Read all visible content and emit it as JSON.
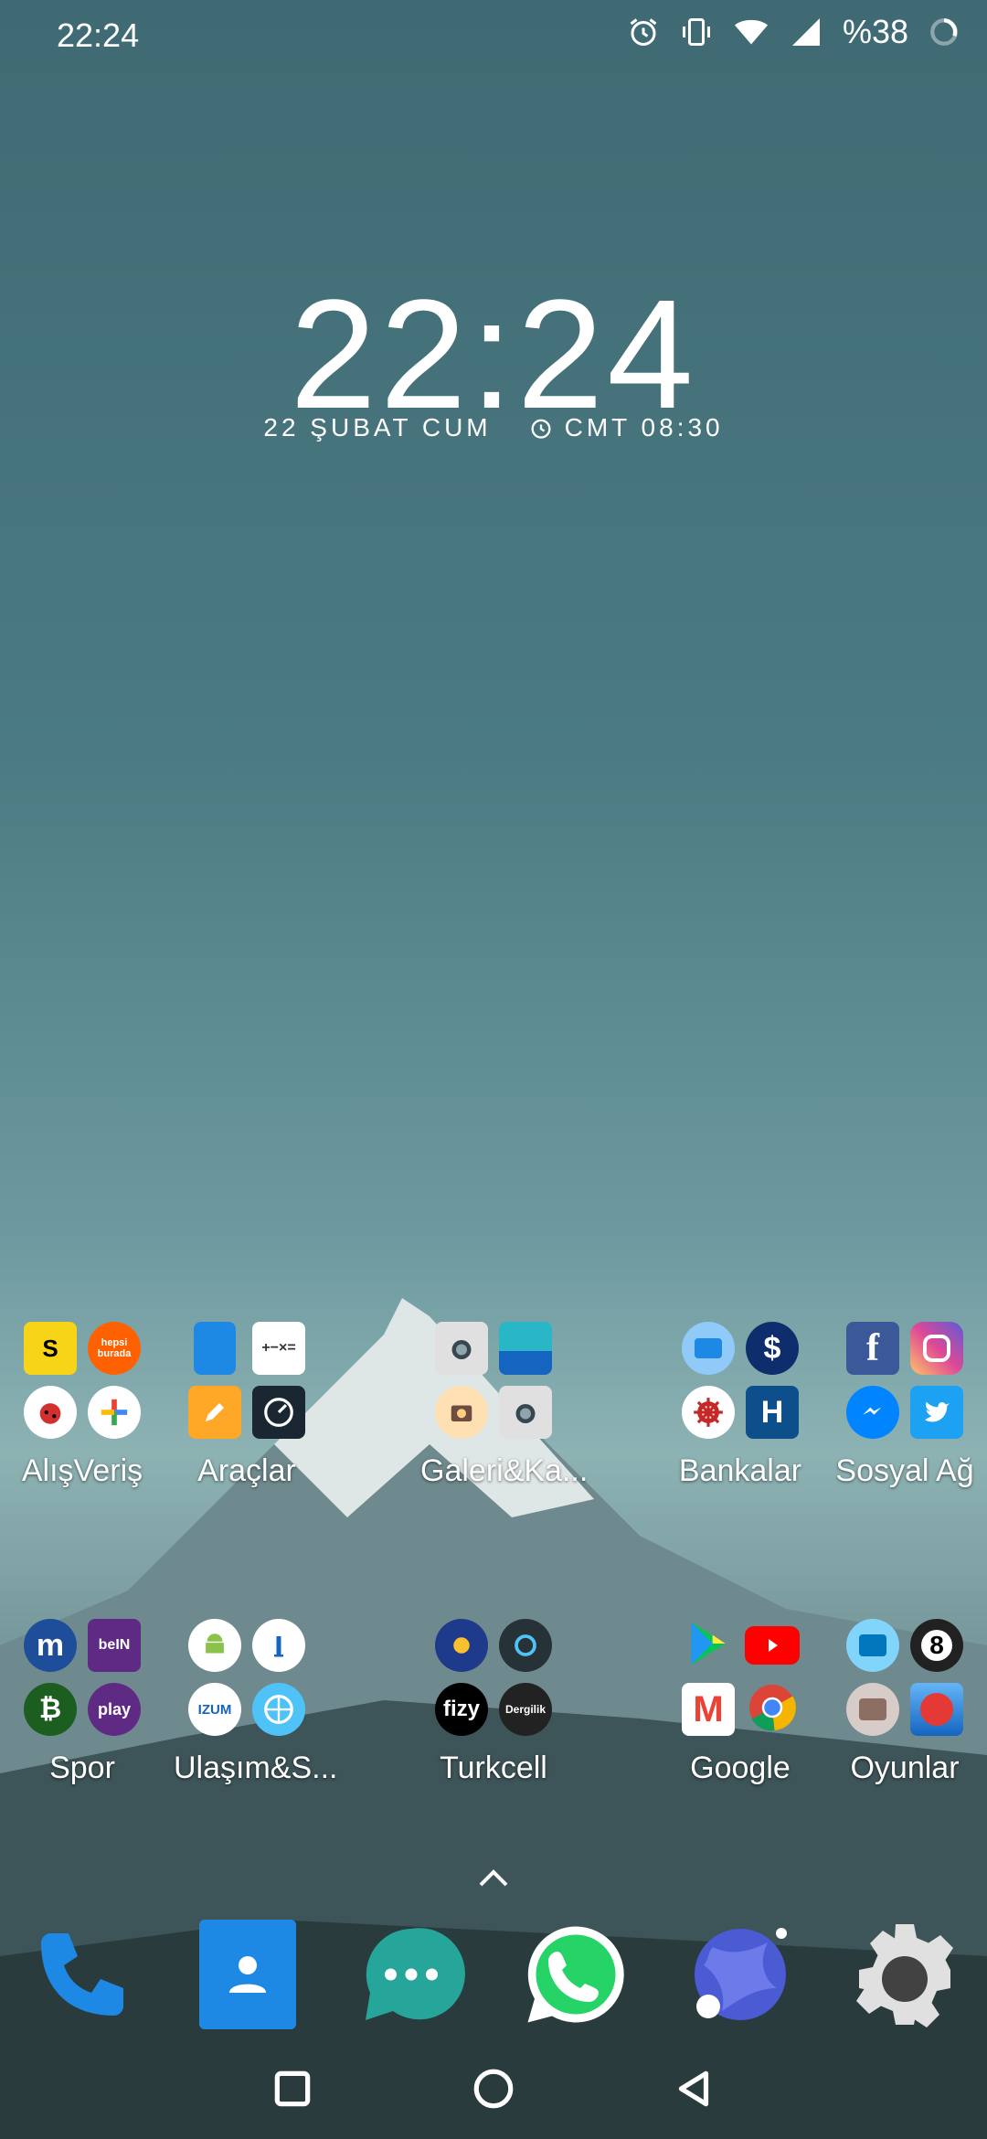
{
  "status_bar": {
    "time": "22:24",
    "battery_text": "%38",
    "icons": [
      "alarm-icon",
      "vibrate-icon",
      "wifi-icon",
      "signal-icon",
      "battery-ring-icon"
    ]
  },
  "clock_widget": {
    "time": "22:24",
    "date": "22 ŞUBAT CUM",
    "alarm": "CMT 08:30"
  },
  "folders": [
    {
      "label": "AlışVeriş",
      "apps": [
        {
          "name": "s-icon",
          "text": "S"
        },
        {
          "name": "hepsiburada-icon",
          "text": "hepsi burada"
        },
        {
          "name": "ladybug-icon",
          "text": ""
        },
        {
          "name": "plus-icon",
          "text": "+"
        }
      ]
    },
    {
      "label": "Araçlar",
      "apps": [
        {
          "name": "notebook-icon",
          "text": ""
        },
        {
          "name": "calculator-icon",
          "text": "+−×="
        },
        {
          "name": "pencil-icon",
          "text": ""
        },
        {
          "name": "speedometer-icon",
          "text": ""
        }
      ]
    },
    {
      "label": "Galeri&Ka...",
      "apps": [
        {
          "name": "camera-icon",
          "text": ""
        },
        {
          "name": "gallery-icon",
          "text": ""
        },
        {
          "name": "camera2-icon",
          "text": ""
        },
        {
          "name": "camera3-icon",
          "text": ""
        }
      ]
    },
    {
      "label": "Bankalar",
      "apps": [
        {
          "name": "bank1-icon",
          "text": ""
        },
        {
          "name": "dollar-icon",
          "text": "$"
        },
        {
          "name": "helm-icon",
          "text": ""
        },
        {
          "name": "halkbank-icon",
          "text": "H"
        }
      ]
    },
    {
      "label": "Sosyal Ağ",
      "apps": [
        {
          "name": "facebook-icon",
          "text": "f"
        },
        {
          "name": "instagram-icon",
          "text": ""
        },
        {
          "name": "messenger-icon",
          "text": ""
        },
        {
          "name": "twitter-icon",
          "text": ""
        }
      ]
    },
    {
      "label": "Spor",
      "apps": [
        {
          "name": "mackolik-icon",
          "text": "m"
        },
        {
          "name": "bein-sports-icon",
          "text": "beIN"
        },
        {
          "name": "bitcoin-icon",
          "text": "₿"
        },
        {
          "name": "play-icon",
          "text": "play"
        }
      ]
    },
    {
      "label": "Ulaşım&S...",
      "apps": [
        {
          "name": "android-icon",
          "text": ""
        },
        {
          "name": "tower-icon",
          "text": ""
        },
        {
          "name": "izum-icon",
          "text": "IZUM"
        },
        {
          "name": "compass-icon",
          "text": ""
        }
      ]
    },
    {
      "label": "Turkcell",
      "apps": [
        {
          "name": "turkcell-icon",
          "text": ""
        },
        {
          "name": "lifebox-icon",
          "text": ""
        },
        {
          "name": "fizy-icon",
          "text": "fizy"
        },
        {
          "name": "dergilik-icon",
          "text": "Dergilik"
        }
      ]
    },
    {
      "label": "Google",
      "apps": [
        {
          "name": "play-store-icon",
          "text": ""
        },
        {
          "name": "youtube-icon",
          "text": ""
        },
        {
          "name": "gmail-icon",
          "text": "M"
        },
        {
          "name": "chrome-icon",
          "text": ""
        }
      ]
    },
    {
      "label": "Oyunlar",
      "apps": [
        {
          "name": "game1-icon",
          "text": ""
        },
        {
          "name": "billiard-icon",
          "text": "8"
        },
        {
          "name": "game3-icon",
          "text": ""
        },
        {
          "name": "bowling-icon",
          "text": ""
        }
      ]
    }
  ],
  "dock": [
    "phone-icon",
    "contacts-icon",
    "messages-icon",
    "whatsapp-icon",
    "browser-icon",
    "settings-icon"
  ],
  "nav": [
    "recents-button",
    "home-button",
    "back-button"
  ],
  "colors": {
    "accent": "#2a7ad8"
  }
}
